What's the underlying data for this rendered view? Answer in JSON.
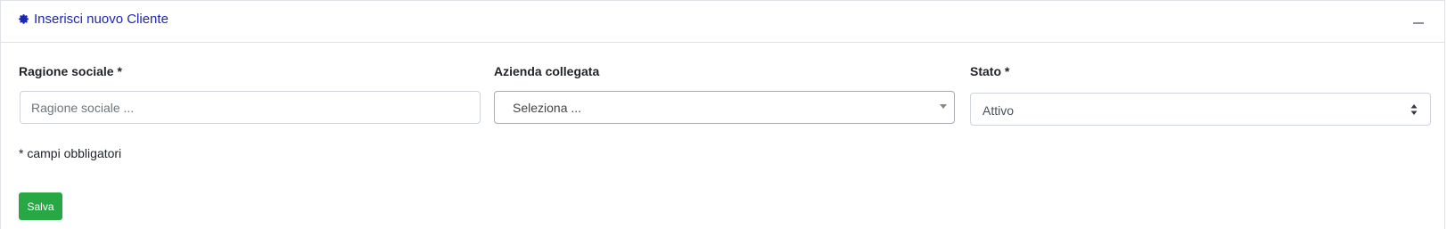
{
  "card": {
    "title": "Inserisci nuovo Cliente",
    "icon": "cog-icon",
    "collapse_icon": "minus-icon"
  },
  "form": {
    "ragione_sociale": {
      "label": "Ragione sociale *",
      "placeholder": "Ragione sociale ...",
      "value": ""
    },
    "azienda_collegata": {
      "label": "Azienda collegata",
      "selected": "Seleziona ..."
    },
    "stato": {
      "label": "Stato *",
      "selected": "Attivo"
    },
    "note": "* campi obbligatori",
    "save_label": "Salva"
  },
  "colors": {
    "title": "#1d27b4",
    "save_button": "#28a745"
  }
}
